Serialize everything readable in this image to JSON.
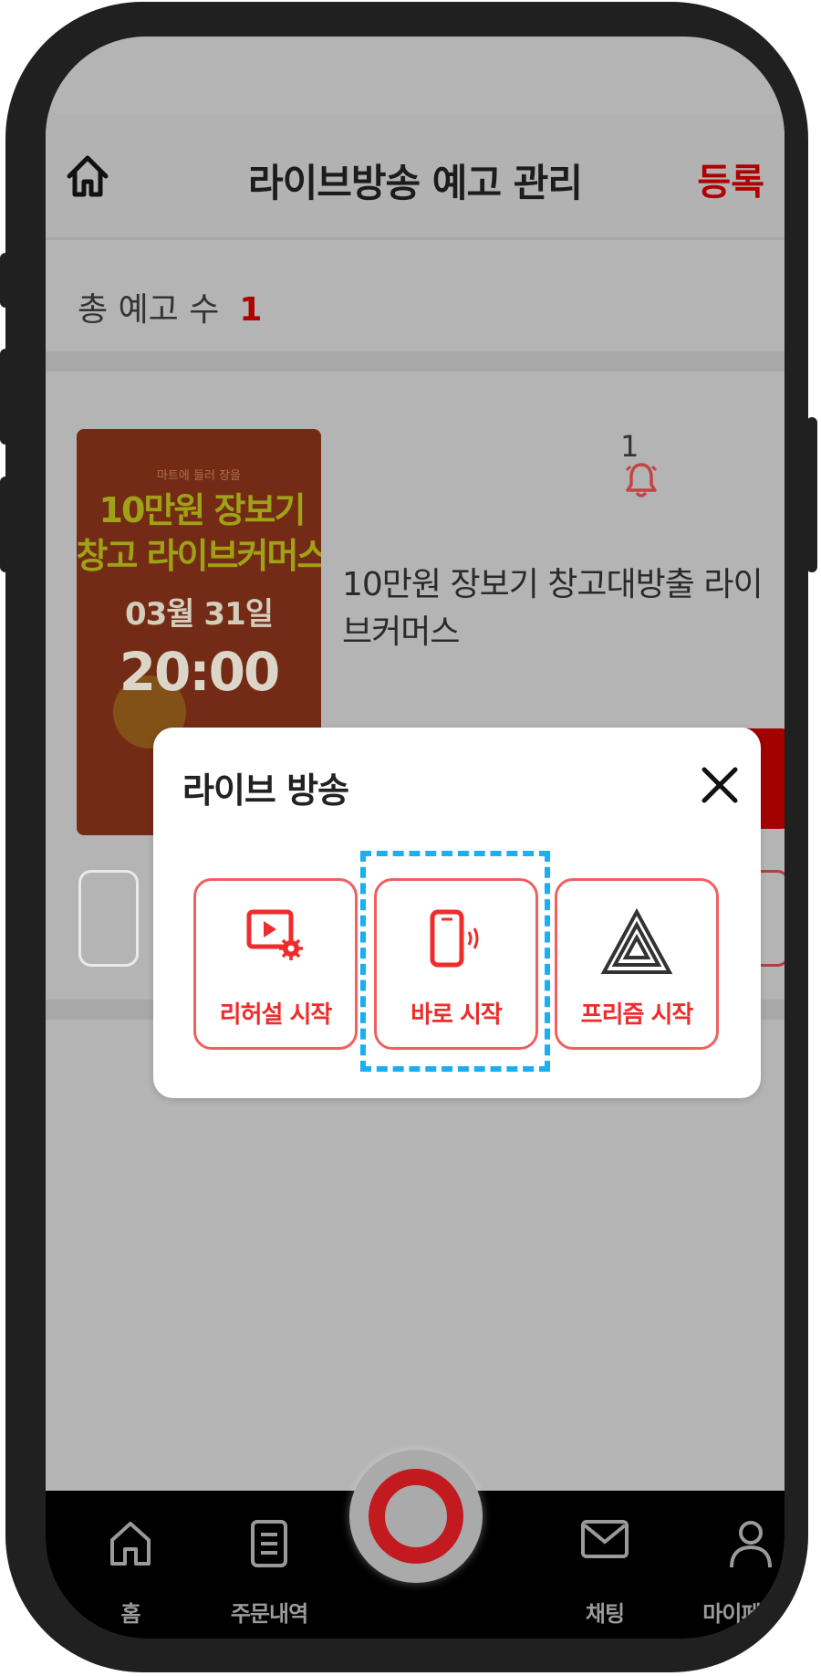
{
  "header": {
    "title": "라이브방송 예고 관리",
    "register_label": "등록"
  },
  "summary": {
    "label": "총 예고 수",
    "count": "1"
  },
  "card": {
    "thumbnail": {
      "small_text": "마트에 들러 장을",
      "line1": "10만원 장보기",
      "line2": "창고 라이브커머스",
      "date": "03월 31일",
      "time": "20:00"
    },
    "notify_count": "1",
    "title": "10만원 장보기 창고대방출 라이브커머스"
  },
  "modal": {
    "title": "라이브 방송",
    "options": [
      {
        "label": "리허설 시작",
        "icon": "rehearsal-video-gear-icon"
      },
      {
        "label": "바로 시작",
        "icon": "phone-broadcast-icon"
      },
      {
        "label": "프리즘 시작",
        "icon": "prism-triangle-icon"
      }
    ],
    "highlighted_option": "바로 시작"
  },
  "nav": {
    "items": [
      {
        "label": "홈",
        "icon": "home-icon"
      },
      {
        "label": "주문내역",
        "icon": "order-list-icon"
      },
      {
        "label": "채팅",
        "icon": "mail-icon"
      },
      {
        "label": "마이페이지",
        "icon": "person-icon"
      }
    ]
  },
  "colors": {
    "accent_red": "#ee2c2c",
    "dark_red": "#b00000",
    "focus_blue": "#1aaff0",
    "overlay_gray": "#b4b4b4"
  }
}
